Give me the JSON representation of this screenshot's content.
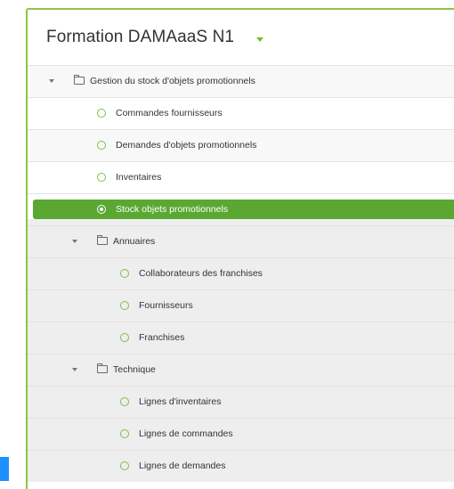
{
  "header": {
    "title": "Formation DAMAaaS N1"
  },
  "colors": {
    "accent": "#5aa832",
    "frame_border": "#8cc63f",
    "item_icon": "#7cbf44",
    "scroll_marker": "#1e90ff"
  },
  "tree": {
    "groups": [
      {
        "label": "Gestion du stock d'objets promotionnels",
        "icon": "folder-icon",
        "expanded": true,
        "items": [
          {
            "label": "Commandes fournisseurs",
            "icon": "circle-icon"
          },
          {
            "label": "Demandes d'objets promotionnels",
            "icon": "circle-icon"
          },
          {
            "label": "Inventaires",
            "icon": "circle-icon"
          },
          {
            "label": "Stock objets promotionnels",
            "icon": "radio-selected-icon",
            "selected": true
          }
        ]
      },
      {
        "label": "Annuaires",
        "icon": "folder-icon",
        "expanded": true,
        "items": [
          {
            "label": "Collaborateurs des franchises",
            "icon": "circle-icon"
          },
          {
            "label": "Fournisseurs",
            "icon": "circle-icon"
          },
          {
            "label": "Franchises",
            "icon": "circle-icon"
          }
        ]
      },
      {
        "label": "Technique",
        "icon": "folder-icon",
        "expanded": true,
        "items": [
          {
            "label": "Lignes d'inventaires",
            "icon": "circle-icon"
          },
          {
            "label": "Lignes de commandes",
            "icon": "circle-icon"
          },
          {
            "label": "Lignes de demandes",
            "icon": "circle-icon"
          }
        ]
      }
    ]
  }
}
